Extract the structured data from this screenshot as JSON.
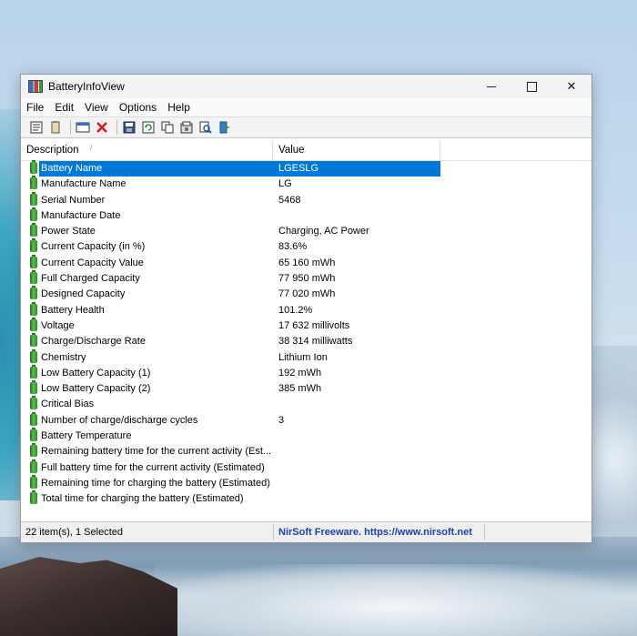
{
  "window": {
    "title": "BatteryInfoView",
    "controls": {
      "minimize": "",
      "maximize": "",
      "close": "✕"
    }
  },
  "menu": [
    "File",
    "Edit",
    "View",
    "Options",
    "Help"
  ],
  "toolbar": {
    "icons": [
      "properties-icon",
      "copy-icon",
      "html-report-icon",
      "delete-icon",
      "save-icon",
      "refresh-icon",
      "copy-selected-icon",
      "options-icon",
      "search-icon",
      "exit-icon"
    ]
  },
  "columns": {
    "description": "Description",
    "value": "Value"
  },
  "rows": [
    {
      "desc": "Battery Name",
      "value": "LGESLG",
      "selected": true
    },
    {
      "desc": "Manufacture Name",
      "value": "LG"
    },
    {
      "desc": "Serial Number",
      "value": "5468"
    },
    {
      "desc": "Manufacture Date",
      "value": ""
    },
    {
      "desc": "Power State",
      "value": "Charging, AC Power"
    },
    {
      "desc": "Current Capacity (in %)",
      "value": "83.6%"
    },
    {
      "desc": "Current Capacity Value",
      "value": "65 160 mWh"
    },
    {
      "desc": "Full Charged Capacity",
      "value": "77 950 mWh"
    },
    {
      "desc": "Designed Capacity",
      "value": "77 020 mWh"
    },
    {
      "desc": "Battery Health",
      "value": "101.2%"
    },
    {
      "desc": "Voltage",
      "value": "17 632 millivolts"
    },
    {
      "desc": "Charge/Discharge Rate",
      "value": "38 314 milliwatts"
    },
    {
      "desc": "Chemistry",
      "value": "Lithium Ion"
    },
    {
      "desc": "Low Battery Capacity (1)",
      "value": "192 mWh"
    },
    {
      "desc": "Low Battery Capacity (2)",
      "value": "385 mWh"
    },
    {
      "desc": "Critical Bias",
      "value": ""
    },
    {
      "desc": "Number of charge/discharge cycles",
      "value": "3"
    },
    {
      "desc": "Battery Temperature",
      "value": ""
    },
    {
      "desc": "Remaining battery time for the current activity (Est...",
      "value": ""
    },
    {
      "desc": "Full battery time for the current activity (Estimated)",
      "value": ""
    },
    {
      "desc": "Remaining time for charging the battery (Estimated)",
      "value": ""
    },
    {
      "desc": "Total  time for charging the battery (Estimated)",
      "value": ""
    }
  ],
  "status": {
    "count": "22 item(s), 1 Selected",
    "credit": "NirSoft Freeware. https://www.nirsoft.net"
  },
  "colors": {
    "selection": "#0078d7",
    "credit_link": "#1d3fb0"
  }
}
